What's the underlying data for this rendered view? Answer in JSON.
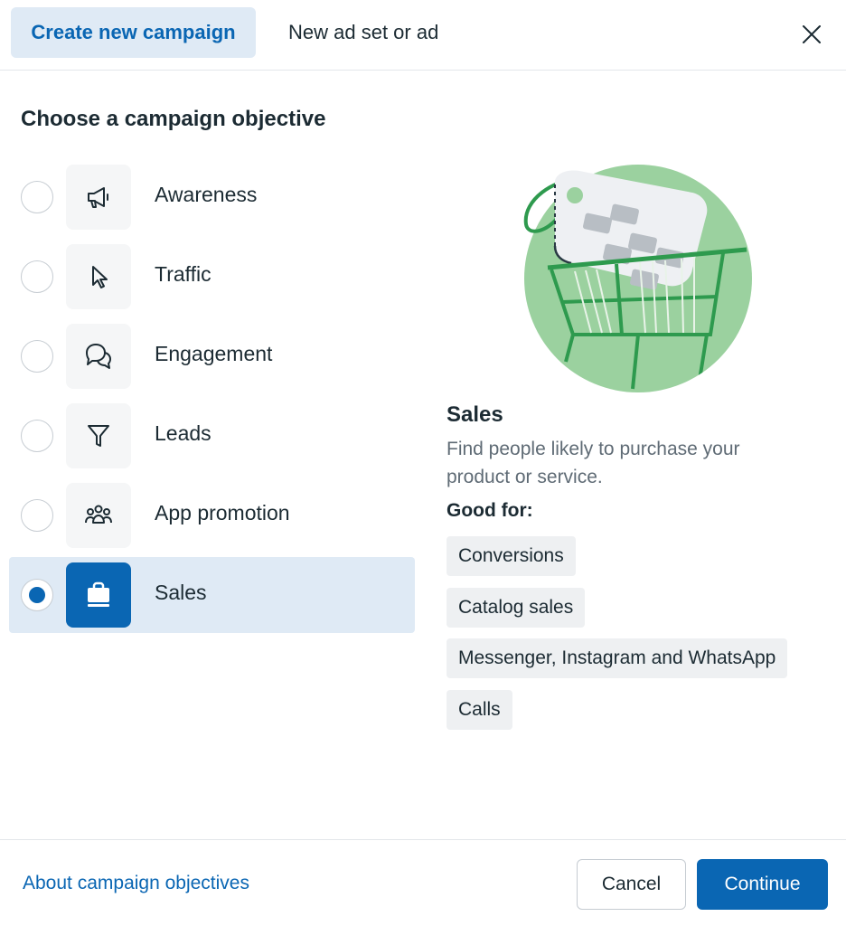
{
  "tabs": {
    "create_new_campaign": "Create new campaign",
    "new_ad_set_or_ad": "New ad set or ad"
  },
  "page": {
    "title": "Choose a campaign objective"
  },
  "objectives": [
    {
      "label": "Awareness",
      "icon": "megaphone-icon",
      "selected": false
    },
    {
      "label": "Traffic",
      "icon": "cursor-icon",
      "selected": false
    },
    {
      "label": "Engagement",
      "icon": "chat-bubbles-icon",
      "selected": false
    },
    {
      "label": "Leads",
      "icon": "funnel-icon",
      "selected": false
    },
    {
      "label": "App promotion",
      "icon": "people-icon",
      "selected": false
    },
    {
      "label": "Sales",
      "icon": "shopping-bag-icon",
      "selected": true
    }
  ],
  "detail": {
    "title": "Sales",
    "description": "Find people likely to purchase your product or service.",
    "good_for_label": "Good for:",
    "chips": [
      "Conversions",
      "Catalog sales",
      "Messenger, Instagram and WhatsApp",
      "Calls"
    ]
  },
  "footer": {
    "link": "About campaign objectives",
    "cancel": "Cancel",
    "continue": "Continue"
  },
  "colors": {
    "accent": "#0a66b3",
    "selected_bg": "#dfeaf5",
    "illustration_green": "#9bd19f",
    "illustration_dark_green": "#2e9a4e"
  }
}
